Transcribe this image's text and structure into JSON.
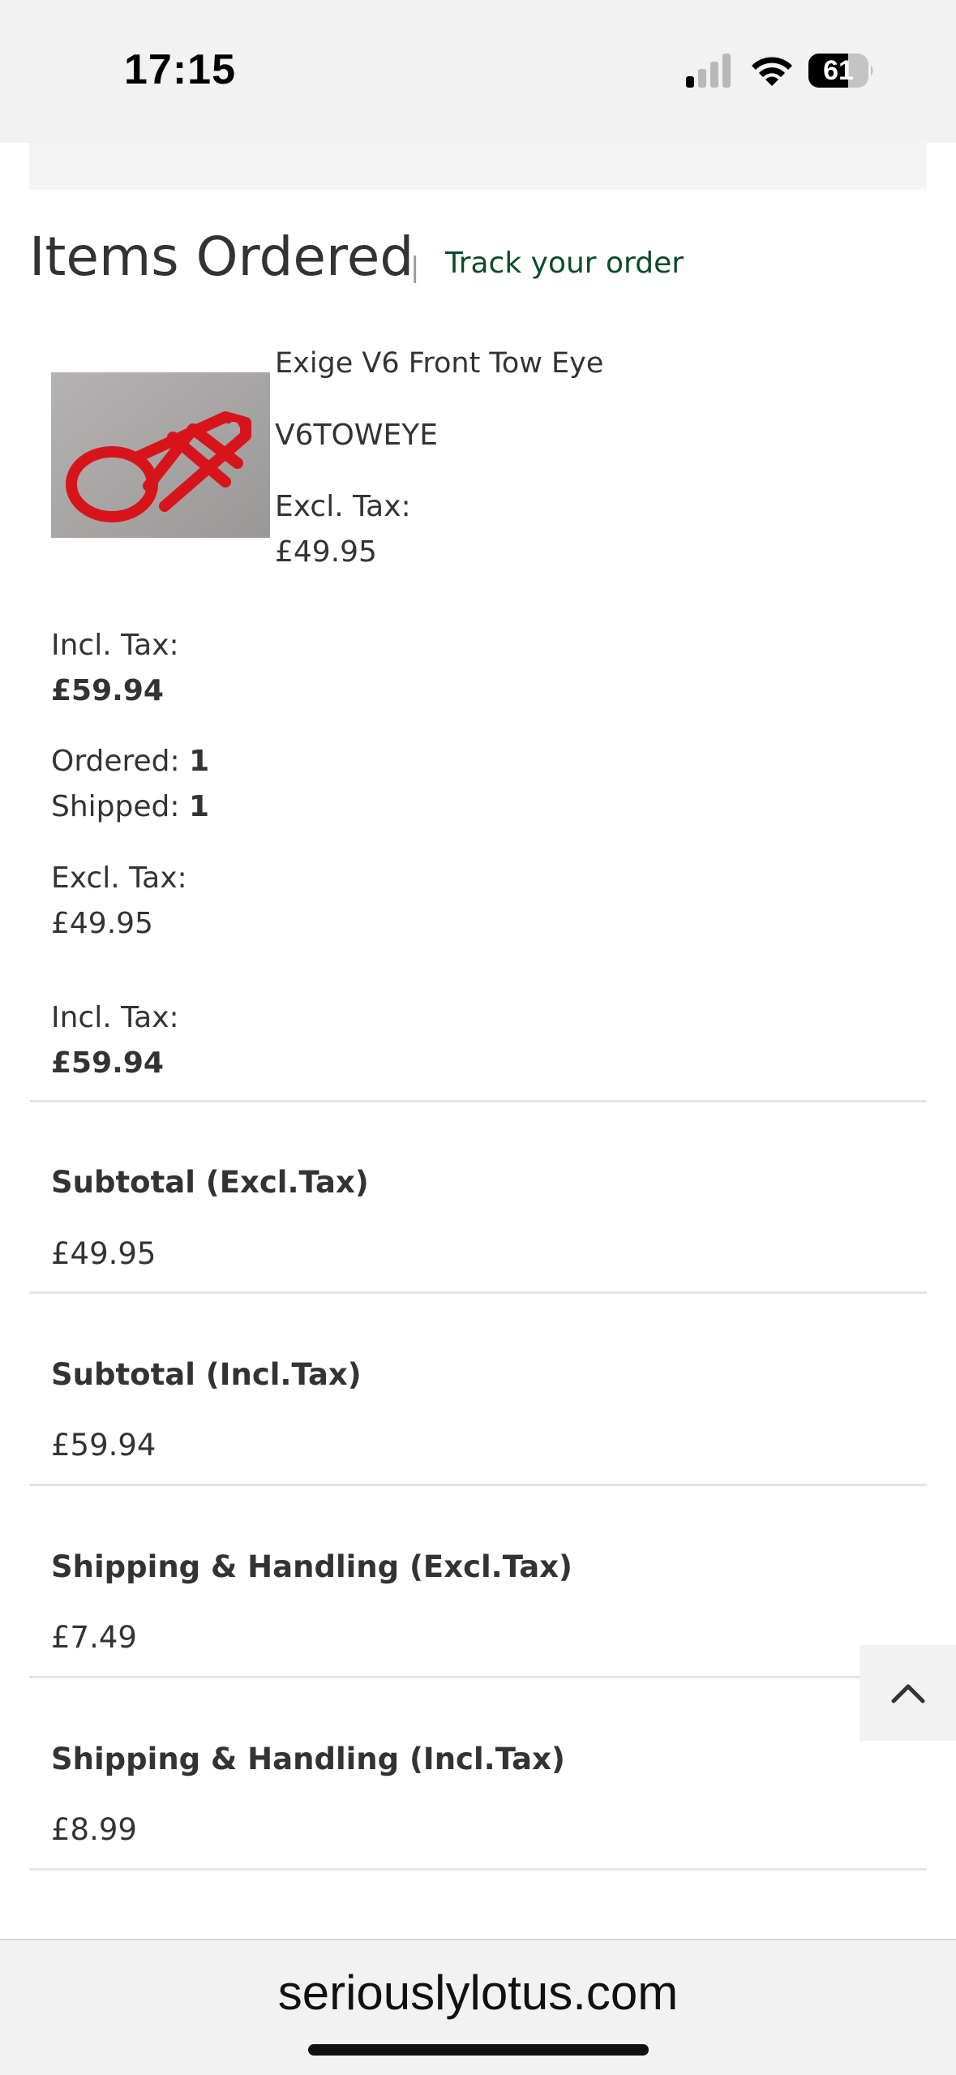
{
  "status_bar": {
    "time": "17:15",
    "battery_level": "61",
    "signal_icon": "cellular-signal-icon",
    "wifi_icon": "wifi-icon",
    "battery_icon": "battery-icon"
  },
  "items_section": {
    "heading": "Items Ordered",
    "separator": "|",
    "track_link": "Track your order",
    "link_color": "#0b4a2a"
  },
  "product": {
    "name": "Exige V6 Front Tow Eye",
    "sku": "V6TOWEYE",
    "price_excl_label": "Excl. Tax:",
    "price_excl_value": "£49.95",
    "price_incl_label": "Incl. Tax:",
    "price_incl_value": "£59.94",
    "ordered_label": "Ordered:",
    "ordered_qty": "1",
    "shipped_label": "Shipped:",
    "shipped_qty": "1",
    "row_excl_label": "Excl. Tax:",
    "row_excl_value": "£49.95",
    "row_incl_label": "Incl. Tax:",
    "row_incl_value": "£59.94",
    "image_icon": "red-tow-eye-image"
  },
  "totals": [
    {
      "label": "Subtotal (Excl.Tax)",
      "value": "£49.95"
    },
    {
      "label": "Subtotal (Incl.Tax)",
      "value": "£59.94"
    },
    {
      "label": "Shipping & Handling (Excl.Tax)",
      "value": "£7.49"
    },
    {
      "label": "Shipping & Handling (Incl.Tax)",
      "value": "£8.99"
    }
  ],
  "scroll_top_icon": "chevron-up-icon",
  "browser": {
    "domain": "seriouslylotus.com"
  }
}
